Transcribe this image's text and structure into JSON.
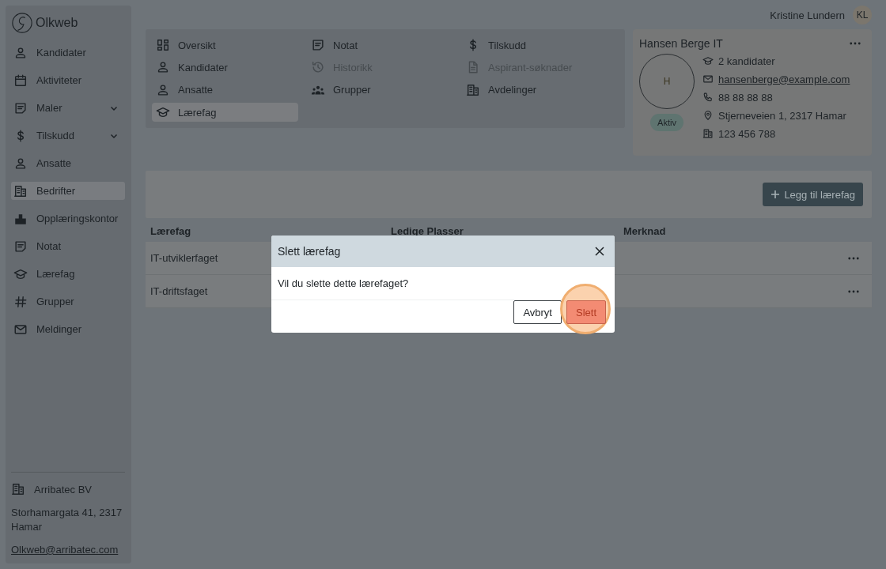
{
  "sidebar": {
    "logo": "Olkweb",
    "items": [
      {
        "label": "Kandidater",
        "expandable": false,
        "selected": false
      },
      {
        "label": "Aktiviteter",
        "expandable": false,
        "selected": false
      },
      {
        "label": "Maler",
        "expandable": true,
        "selected": false
      },
      {
        "label": "Tilskudd",
        "expandable": true,
        "selected": false
      },
      {
        "label": "Ansatte",
        "expandable": false,
        "selected": false
      },
      {
        "label": "Bedrifter",
        "expandable": false,
        "selected": true
      },
      {
        "label": "Opplæringskontor",
        "expandable": false,
        "selected": false
      },
      {
        "label": "Notat",
        "expandable": false,
        "selected": false
      },
      {
        "label": "Lærefag",
        "expandable": false,
        "selected": false
      },
      {
        "label": "Grupper",
        "expandable": false,
        "selected": false
      },
      {
        "label": "Meldinger",
        "expandable": false,
        "selected": false
      }
    ],
    "footer": {
      "company": "Arribatec BV",
      "address": "Storhamargata 41, 2317 Hamar",
      "email": "Olkweb@arribatec.com"
    }
  },
  "user": {
    "name": "Kristine Lundern",
    "initials": "KL"
  },
  "nav": [
    {
      "label": "Oversikt",
      "selected": false,
      "disabled": false
    },
    {
      "label": "Notat",
      "selected": false,
      "disabled": false
    },
    {
      "label": "Tilskudd",
      "selected": false,
      "disabled": false
    },
    {
      "label": "Kandidater",
      "selected": false,
      "disabled": false
    },
    {
      "label": "Historikk",
      "selected": false,
      "disabled": true
    },
    {
      "label": "Aspirant-søknader",
      "selected": false,
      "disabled": true
    },
    {
      "label": "Ansatte",
      "selected": false,
      "disabled": false
    },
    {
      "label": "Grupper",
      "selected": false,
      "disabled": false
    },
    {
      "label": "Avdelinger",
      "selected": false,
      "disabled": false
    },
    {
      "label": "Lærefag",
      "selected": true,
      "disabled": false
    }
  ],
  "company_card": {
    "title": "Hansen Berge IT",
    "initial": "H",
    "status": "Aktiv",
    "details": [
      {
        "kind": "text",
        "text": "2 kandidater"
      },
      {
        "kind": "link",
        "text": "hansenberge@example.com"
      },
      {
        "kind": "text",
        "text": "88 88 88 88"
      },
      {
        "kind": "text",
        "text": "Stjerneveien 1, 2317 Hamar"
      },
      {
        "kind": "text",
        "text": "123 456 788"
      }
    ]
  },
  "toolbar": {
    "add_button": "Legg til lærefag"
  },
  "table": {
    "columns": [
      "Lærefag",
      "Ledige Plasser",
      "Merknad"
    ],
    "rows": [
      {
        "laerefag": "IT-utviklerfaget"
      },
      {
        "laerefag": "IT-driftsfaget"
      }
    ]
  },
  "dialog": {
    "title": "Slett lærefag",
    "message": "Vil du slette dette lærefaget?",
    "buttons": [
      {
        "label": "Avbryt",
        "kind": "secondary",
        "highlighted": false
      },
      {
        "label": "Slett",
        "kind": "danger",
        "highlighted": true
      }
    ]
  }
}
